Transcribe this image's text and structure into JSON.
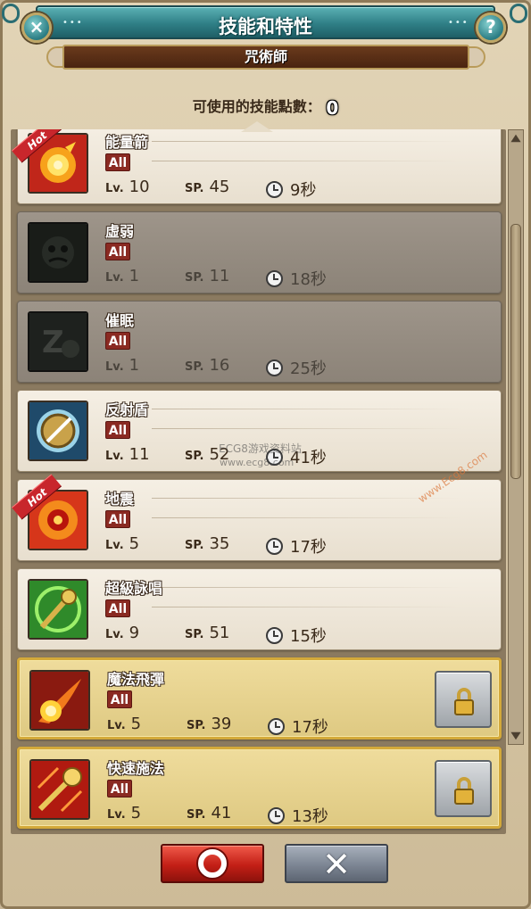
{
  "header": {
    "title": "技能和特性",
    "class_name": "咒術師",
    "close_icon": "×",
    "help_icon": "?",
    "dots_left": "•••",
    "dots_right": "•••"
  },
  "skill_points": {
    "label": "可使用的技能點數：",
    "value": "0"
  },
  "skills": [
    {
      "name": "能量箭",
      "tag": "All",
      "lv_label": "Lv.",
      "lv": "10",
      "sp_label": "SP.",
      "sp": "45",
      "cooldown": "9秒",
      "state": "normal",
      "hot": true,
      "hot_label": "Hot",
      "icon": "energy-arrow-icon"
    },
    {
      "name": "虛弱",
      "tag": "All",
      "lv_label": "Lv.",
      "lv": "1",
      "sp_label": "SP.",
      "sp": "11",
      "cooldown": "18秒",
      "state": "dim",
      "hot": false,
      "icon": "weakness-icon"
    },
    {
      "name": "催眠",
      "tag": "All",
      "lv_label": "Lv.",
      "lv": "1",
      "sp_label": "SP.",
      "sp": "16",
      "cooldown": "25秒",
      "state": "dim",
      "hot": false,
      "icon": "hypnosis-icon"
    },
    {
      "name": "反射盾",
      "tag": "All",
      "lv_label": "Lv.",
      "lv": "11",
      "sp_label": "SP.",
      "sp": "52",
      "cooldown": "41秒",
      "state": "normal",
      "hot": false,
      "icon": "reflect-shield-icon"
    },
    {
      "name": "地震",
      "tag": "All",
      "lv_label": "Lv.",
      "lv": "5",
      "sp_label": "SP.",
      "sp": "35",
      "cooldown": "17秒",
      "state": "normal",
      "hot": true,
      "hot_label": "Hot",
      "icon": "earthquake-icon"
    },
    {
      "name": "超級詠唱",
      "tag": "All",
      "lv_label": "Lv.",
      "lv": "9",
      "sp_label": "SP.",
      "sp": "51",
      "cooldown": "15秒",
      "state": "normal",
      "hot": false,
      "icon": "super-chant-icon"
    },
    {
      "name": "魔法飛彈",
      "tag": "All",
      "lv_label": "Lv.",
      "lv": "5",
      "sp_label": "SP.",
      "sp": "39",
      "cooldown": "17秒",
      "state": "locked",
      "hot": false,
      "icon": "magic-missile-icon"
    },
    {
      "name": "快速施法",
      "tag": "All",
      "lv_label": "Lv.",
      "lv": "5",
      "sp_label": "SP.",
      "sp": "41",
      "cooldown": "13秒",
      "state": "locked",
      "hot": false,
      "icon": "quick-cast-icon"
    }
  ],
  "watermark": {
    "line1": "ECG8游戏资料站",
    "line2": "www.ecg8.com",
    "diagonal": "www.Ecg8.com"
  },
  "colors": {
    "header_teal": "#2f7f86",
    "tag_red": "#8a2a22",
    "hot_red": "#c8262c",
    "locked_gold": "#d3a93a",
    "confirm_red": "#c31f16",
    "cancel_gray": "#7c8593"
  },
  "buttons": {
    "confirm_icon": "circle-confirm-icon",
    "cancel_icon": "x-cancel-icon",
    "cancel_glyph": "✕"
  }
}
